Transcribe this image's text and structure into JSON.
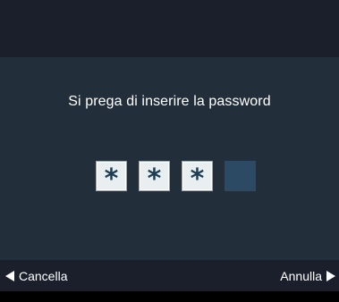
{
  "dialog": {
    "prompt": "Si prega di inserire la password",
    "pin": {
      "mask_char": "*",
      "length": 4,
      "filled": 3
    }
  },
  "footer": {
    "left_label": "Cancella",
    "right_label": "Annulla"
  },
  "colors": {
    "header": "#1a1f2b",
    "body": "#222e3a",
    "pin_empty": "#2c4a63",
    "pin_filled": "#e9eef0",
    "text": "#ffffff"
  },
  "icons": {
    "left": "triangle-left-icon",
    "right": "triangle-right-icon"
  }
}
